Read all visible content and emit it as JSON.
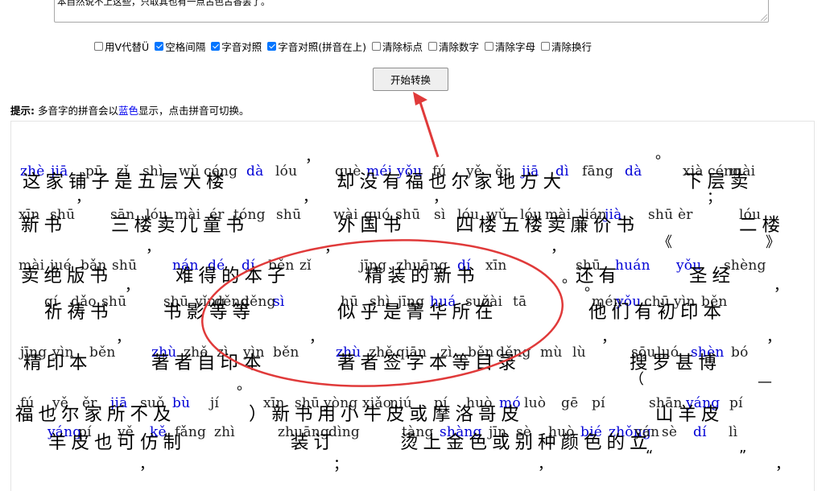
{
  "input": {
    "text": "本自然说不上这些，只取其也有一点古色古香罢了。"
  },
  "options": [
    {
      "label": "用V代替Ü",
      "checked": false
    },
    {
      "label": "空格间隔",
      "checked": true
    },
    {
      "label": "字音对照",
      "checked": true
    },
    {
      "label": "字音对照(拼音在上)",
      "checked": true
    },
    {
      "label": "清除标点",
      "checked": false
    },
    {
      "label": "清除数字",
      "checked": false
    },
    {
      "label": "清除字母",
      "checked": false
    },
    {
      "label": "清除换行",
      "checked": false
    }
  ],
  "convert_button": "开始转换",
  "hint": {
    "bold": "提示:",
    "before": "多音字的拼音会以",
    "blue": "蓝色",
    "after": "显示，点击拼音可切换。"
  },
  "colors": {
    "polyphone": "#0000d6",
    "annotation": "#e03a3a",
    "checkbox": "#0075ff"
  },
  "output": {
    "lines": [
      {
        "pinyin": [
          [
            "zhè",
            1
          ],
          [
            "jiā",
            1
          ],
          [
            "pū",
            0
          ],
          [
            "zǐ",
            0
          ],
          [
            "shì",
            0
          ],
          [
            "wǔ",
            0
          ],
          [
            "céng",
            0
          ],
          [
            "dà",
            1
          ],
          [
            "lóu",
            0
          ],
          [
            "què",
            0
          ],
          [
            "méi",
            1
          ],
          [
            "yǒu",
            1
          ],
          [
            "fú",
            0
          ],
          [
            "yě",
            0
          ],
          [
            "ěr",
            0
          ],
          [
            "jiā",
            1
          ],
          [
            "dì",
            1
          ],
          [
            "fāng",
            0
          ],
          [
            "dà",
            1
          ],
          [
            "xià",
            0
          ],
          [
            "céng",
            0
          ],
          [
            "mài",
            0
          ]
        ],
        "chars": [
          "这家铺子是五层大楼",
          "却没有福也尔家地方大",
          "下层卖"
        ],
        "punct": [
          "，",
          "。"
        ]
      },
      {
        "pinyin": [
          [
            "xīn",
            0
          ],
          [
            "shū",
            0
          ],
          [
            "sān",
            0
          ],
          [
            "lóu",
            0
          ],
          [
            "mài",
            0
          ],
          [
            "ér",
            0
          ],
          [
            "tóng",
            0
          ],
          [
            "shū",
            0
          ],
          [
            "wài",
            0
          ],
          [
            "guó",
            0
          ],
          [
            "shū",
            0
          ],
          [
            "sì",
            0
          ],
          [
            "lóu",
            0
          ],
          [
            "wǔ",
            0
          ],
          [
            "lóu",
            0
          ],
          [
            "mài",
            0
          ],
          [
            "lián",
            0
          ],
          [
            "jià",
            1
          ],
          [
            "shū",
            0
          ],
          [
            "èr",
            0
          ],
          [
            "lóu",
            0
          ]
        ],
        "chars": [
          "新书",
          "三楼卖儿童书",
          "外国书",
          "四楼五楼卖廉价书",
          "二楼"
        ],
        "punct": [
          "，",
          "，",
          "，",
          "；"
        ]
      },
      {
        "pinyin": [
          [
            "mài",
            0
          ],
          [
            "jué",
            0
          ],
          [
            "bǎn",
            0
          ],
          [
            "shū",
            0
          ],
          [
            "nán",
            1
          ],
          [
            "dé",
            1
          ],
          [
            "dí",
            1
          ],
          [
            "běn",
            0
          ],
          [
            "zǐ",
            0
          ],
          [
            "jīng",
            0
          ],
          [
            "zhuāng",
            0
          ],
          [
            "dí",
            1
          ],
          [
            "xīn",
            0
          ],
          [
            "shū",
            0
          ],
          [
            "huán",
            1
          ],
          [
            "yǒu",
            1
          ],
          [
            "shèng",
            0
          ],
          [
            "jīng",
            0
          ]
        ],
        "chars": [
          "卖绝版书",
          "难得的本子",
          "精装的新书",
          "还有",
          "圣经"
        ],
        "punct": [
          "，",
          "，",
          "，",
          "。",
          "《",
          "》"
        ]
      },
      {
        "pinyin": [
          [
            "qí",
            0
          ],
          [
            "dǎo",
            0
          ],
          [
            "shū",
            0
          ],
          [
            "shū",
            0
          ],
          [
            "yǐng",
            0
          ],
          [
            "děng",
            0
          ],
          [
            "děng",
            0
          ],
          [
            "sì",
            1
          ],
          [
            "hū",
            0
          ],
          [
            "shì",
            0
          ],
          [
            "jīng",
            0
          ],
          [
            "huá",
            1
          ],
          [
            "suǒ",
            0
          ],
          [
            "zài",
            0
          ],
          [
            "tā",
            0
          ],
          [
            "mén",
            0
          ],
          [
            "yǒu",
            1
          ],
          [
            "chū",
            0
          ],
          [
            "yìn",
            0
          ],
          [
            "běn",
            0
          ]
        ],
        "chars": [
          "祈祷书",
          "书影等等",
          "似乎是菁华所在",
          "他们有初印本"
        ],
        "punct": [
          "，",
          "。",
          "，"
        ]
      },
      {
        "pinyin": [
          [
            "jīng",
            0
          ],
          [
            "yìn",
            0
          ],
          [
            "běn",
            0
          ],
          [
            "zhù",
            1
          ],
          [
            "zhě",
            0
          ],
          [
            "zì",
            0
          ],
          [
            "yìn",
            0
          ],
          [
            "běn",
            0
          ],
          [
            "zhù",
            1
          ],
          [
            "zhě",
            0
          ],
          [
            "qiān",
            0
          ],
          [
            "zì",
            0
          ],
          [
            "běn",
            0
          ],
          [
            "děng",
            0
          ],
          [
            "mù",
            0
          ],
          [
            "lù",
            0
          ],
          [
            "sōu",
            0
          ],
          [
            "luó",
            0
          ],
          [
            "shèn",
            1
          ],
          [
            "bó",
            0
          ]
        ],
        "chars": [
          "精印本",
          "著者自印本",
          "著者签字本等目录",
          "搜罗甚博"
        ],
        "punct": [
          "，",
          "，",
          "，",
          "，"
        ]
      },
      {
        "pinyin": [
          [
            "fú",
            0
          ],
          [
            "yě",
            0
          ],
          [
            "ěr",
            0
          ],
          [
            "jiā",
            1
          ],
          [
            "suǒ",
            0
          ],
          [
            "bù",
            1
          ],
          [
            "jí",
            0
          ],
          [
            "xīn",
            0
          ],
          [
            "shū",
            0
          ],
          [
            "yòng",
            0
          ],
          [
            "xiǎo",
            0
          ],
          [
            "niú",
            0
          ],
          [
            "pí",
            0
          ],
          [
            "huò",
            0
          ],
          [
            "mó",
            1
          ],
          [
            "luò",
            0
          ],
          [
            "gē",
            0
          ],
          [
            "pí",
            0
          ],
          [
            "shān",
            0
          ],
          [
            "yáng",
            1
          ],
          [
            "pí",
            0
          ]
        ],
        "chars": [
          "福也尔家所不及",
          "）新书用小牛皮或摩洛哥皮",
          "山羊皮"
        ],
        "punct": [
          "。",
          "（",
          "—"
        ]
      },
      {
        "pinyin": [
          [
            "yáng",
            1
          ],
          [
            "pí",
            0
          ],
          [
            "yě",
            0
          ],
          [
            "kě",
            1
          ],
          [
            "fǎng",
            0
          ],
          [
            "zhì",
            0
          ],
          [
            "zhuāng",
            0
          ],
          [
            "dìng",
            0
          ],
          [
            "tàng",
            0
          ],
          [
            "shàng",
            1
          ],
          [
            "jīn",
            0
          ],
          [
            "sè",
            0
          ],
          [
            "huò",
            0
          ],
          [
            "bié",
            1
          ],
          [
            "zhǒng",
            1
          ],
          [
            "yán",
            0
          ],
          [
            "sè",
            0
          ],
          [
            "dí",
            1
          ],
          [
            "lì",
            0
          ]
        ],
        "chars": [
          "羊皮也可仿制",
          "装订",
          "烫上金色或别种颜色的立"
        ],
        "punct": [
          "，",
          "；",
          "，",
          "“",
          "”",
          "，"
        ]
      }
    ]
  }
}
